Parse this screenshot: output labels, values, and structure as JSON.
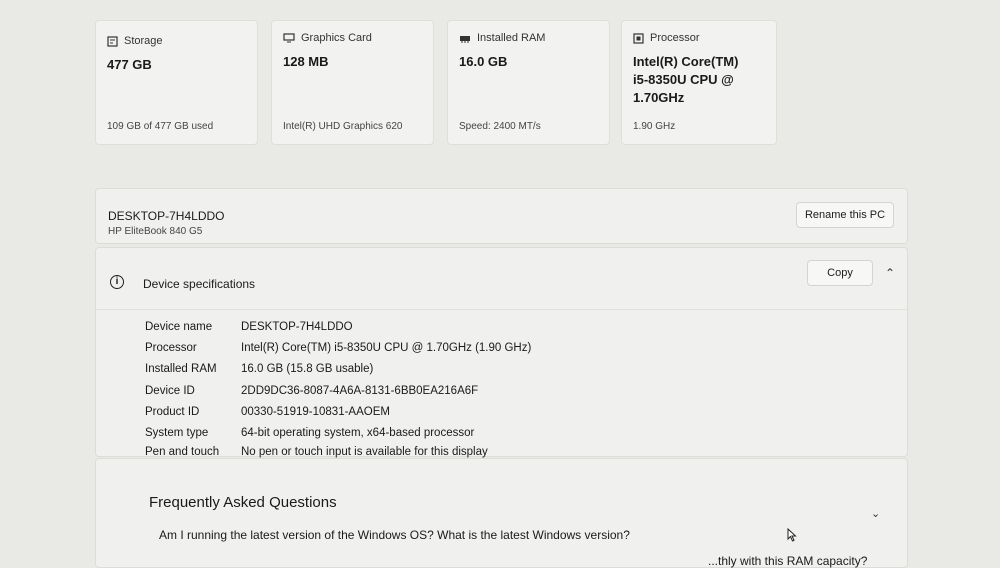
{
  "cards": [
    {
      "icon": "storage-icon",
      "label": "Storage",
      "value": "477 GB",
      "sub": "109 GB of 477 GB used"
    },
    {
      "icon": "graphics-card-icon",
      "label": "Graphics Card",
      "value": "128 MB",
      "sub": "Intel(R) UHD Graphics 620"
    },
    {
      "icon": "ram-icon",
      "label": "Installed RAM",
      "value": "16.0 GB",
      "sub": "Speed: 2400 MT/s"
    },
    {
      "icon": "processor-icon",
      "label": "Processor",
      "value_lines": [
        "Intel(R) Core(TM)",
        "i5-8350U CPU @",
        "1.70GHz"
      ],
      "sub": "1.90 GHz"
    }
  ],
  "device": {
    "name": "DESKTOP-7H4LDDO",
    "model": "HP EliteBook 840 G5",
    "rename_label": "Rename this PC"
  },
  "specs": {
    "title": "Device specifications",
    "copy_label": "Copy",
    "rows": [
      {
        "key": "Device name",
        "value": "DESKTOP-7H4LDDO"
      },
      {
        "key": "Processor",
        "value": "Intel(R) Core(TM) i5-8350U CPU @ 1.70GHz (1.90 GHz)"
      },
      {
        "key": "Installed RAM",
        "value": "16.0 GB (15.8 GB usable)"
      },
      {
        "key": "Device ID",
        "value": "2DD9DC36-8087-4A6A-8131-6BB0EA216A6F"
      },
      {
        "key": "Product ID",
        "value": "00330-51919-10831-AAOEM"
      },
      {
        "key": "System type",
        "value": "64-bit operating system, x64-based processor"
      },
      {
        "key": "Pen and touch",
        "value": "No pen or touch input is available for this display"
      }
    ]
  },
  "faq": {
    "heading": "Frequently Asked Questions",
    "q1": "Am I running the latest version of the Windows OS? What is the latest Windows version?",
    "q2_partial": "...thly with this RAM capacity?"
  }
}
